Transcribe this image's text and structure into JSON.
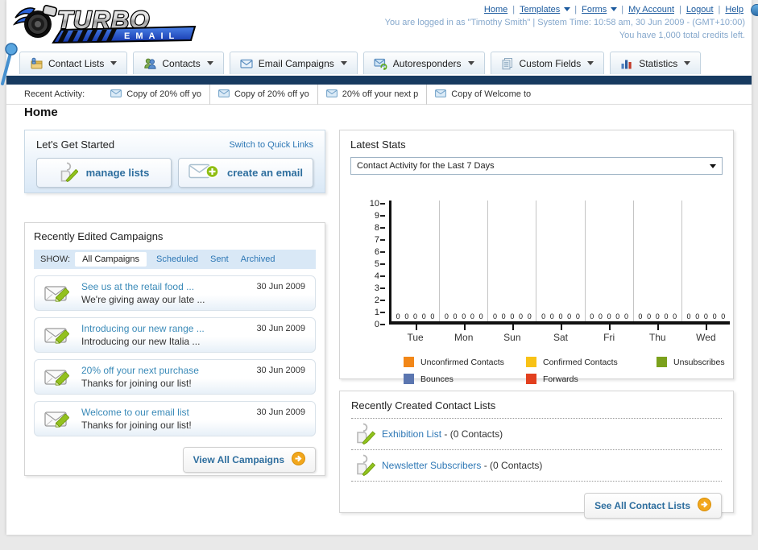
{
  "colors": {
    "nav_bar": "#173a60",
    "link": "#2d77b5",
    "arrow_button": "#f2a71c"
  },
  "header": {
    "logo_title": "TURBO",
    "logo_subtitle": "EMAIL",
    "links": [
      {
        "label": "Home",
        "dropdown": false
      },
      {
        "label": "Templates",
        "dropdown": true
      },
      {
        "label": "Forms",
        "dropdown": true
      },
      {
        "label": "My Account",
        "dropdown": false
      },
      {
        "label": "Logout",
        "dropdown": false
      },
      {
        "label": "Help",
        "dropdown": false
      }
    ],
    "login_status": "You are logged in as \"Timothy Smith\" | System Time: 10:58 am, 30 Jun 2009 - (GMT+10:00)",
    "credits": "You have 1,000 total credits left."
  },
  "tabs": [
    {
      "label": "Contact Lists",
      "icon": "contact-lists-icon"
    },
    {
      "label": "Contacts",
      "icon": "contacts-icon"
    },
    {
      "label": "Email Campaigns",
      "icon": "email-campaigns-icon"
    },
    {
      "label": "Autoresponders",
      "icon": "autoresponders-icon"
    },
    {
      "label": "Custom Fields",
      "icon": "custom-fields-icon"
    },
    {
      "label": "Statistics",
      "icon": "statistics-icon"
    }
  ],
  "recent_activity": {
    "label": "Recent Activity:",
    "items": [
      "Copy of 20% off yo",
      "Copy of 20% off yo",
      "20% off your next p",
      "Copy of Welcome to"
    ]
  },
  "home_title": "Home",
  "get_started": {
    "title": "Let's Get Started",
    "switch_link": "Switch to Quick Links",
    "buttons": [
      {
        "label": "manage lists",
        "icon": "manage-lists-icon"
      },
      {
        "label": "create an email",
        "icon": "create-email-icon"
      }
    ]
  },
  "campaigns": {
    "title": "Recently Edited Campaigns",
    "show_label": "SHOW:",
    "filters": [
      {
        "label": "All Campaigns",
        "active": true
      },
      {
        "label": "Scheduled",
        "active": false
      },
      {
        "label": "Sent",
        "active": false
      },
      {
        "label": "Archived",
        "active": false
      }
    ],
    "items": [
      {
        "title": "See us at the retail food ...",
        "subtitle": "We're giving away our late ...",
        "date": "30 Jun 2009"
      },
      {
        "title": "Introducing our new range ...",
        "subtitle": "Introducing our new Italia ...",
        "date": "30 Jun 2009"
      },
      {
        "title": "20% off your next purchase",
        "subtitle": "Thanks for joining our list!",
        "date": "30 Jun 2009"
      },
      {
        "title": "Welcome to our email list",
        "subtitle": "Thanks for joining our list!",
        "date": "30 Jun 2009"
      }
    ],
    "view_all_label": "View All Campaigns"
  },
  "latest_stats": {
    "title": "Latest Stats",
    "dropdown_value": "Contact Activity for the Last 7 Days"
  },
  "chart_data": {
    "type": "bar",
    "title": "Contact Activity for the Last 7 Days",
    "categories": [
      "Tue",
      "Mon",
      "Sun",
      "Sat",
      "Fri",
      "Thu",
      "Wed"
    ],
    "series": [
      {
        "name": "Unconfirmed Contacts",
        "color": "#f28718",
        "values": [
          0,
          0,
          0,
          0,
          0,
          0,
          0
        ]
      },
      {
        "name": "Confirmed Contacts",
        "color": "#f8c216",
        "values": [
          0,
          0,
          0,
          0,
          0,
          0,
          0
        ]
      },
      {
        "name": "Unsubscribes",
        "color": "#7ba11c",
        "values": [
          0,
          0,
          0,
          0,
          0,
          0,
          0
        ]
      },
      {
        "name": "Bounces",
        "color": "#5b76b0",
        "values": [
          0,
          0,
          0,
          0,
          0,
          0,
          0
        ]
      },
      {
        "name": "Forwards",
        "color": "#e2401f",
        "values": [
          0,
          0,
          0,
          0,
          0,
          0,
          0
        ]
      }
    ],
    "ylim": [
      0,
      10
    ],
    "yticks": [
      0,
      1,
      2,
      3,
      4,
      5,
      6,
      7,
      8,
      9,
      10
    ],
    "grid": true,
    "legend_position": "bottom"
  },
  "contact_lists": {
    "title": "Recently Created Contact Lists",
    "items": [
      {
        "name": "Exhibition List",
        "count": "(0 Contacts)"
      },
      {
        "name": "Newsletter Subscribers",
        "count": "(0 Contacts)"
      }
    ],
    "see_all_label": "See All Contact Lists"
  }
}
